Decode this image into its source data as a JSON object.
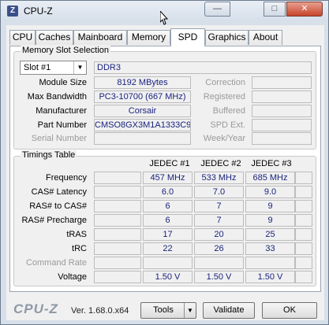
{
  "window": {
    "app_icon": "Z",
    "title": "CPU-Z",
    "minimize": "—",
    "maximize": "□",
    "close": "✕"
  },
  "tabs": [
    "CPU",
    "Caches",
    "Mainboard",
    "Memory",
    "SPD",
    "Graphics",
    "About"
  ],
  "active_tab": "SPD",
  "memory_slot": {
    "group_title": "Memory Slot Selection",
    "slot_value": "Slot #1",
    "type": "DDR3",
    "module_size_label": "Module Size",
    "module_size": "8192 MBytes",
    "max_bandwidth_label": "Max Bandwidth",
    "max_bandwidth": "PC3-10700 (667 MHz)",
    "manufacturer_label": "Manufacturer",
    "manufacturer": "Corsair",
    "part_number_label": "Part Number",
    "part_number": "CMSO8GX3M1A1333C9",
    "serial_number_label": "Serial Number",
    "serial_number": "",
    "correction_label": "Correction",
    "correction": "",
    "registered_label": "Registered",
    "registered": "",
    "buffered_label": "Buffered",
    "buffered": "",
    "spd_ext_label": "SPD Ext.",
    "spd_ext": "",
    "week_year_label": "Week/Year",
    "week_year": ""
  },
  "timings": {
    "group_title": "Timings Table",
    "columns": [
      "JEDEC #1",
      "JEDEC #2",
      "JEDEC #3",
      ""
    ],
    "rows": [
      {
        "label": "Frequency",
        "values": [
          "457 MHz",
          "533 MHz",
          "685 MHz",
          ""
        ]
      },
      {
        "label": "CAS# Latency",
        "values": [
          "6.0",
          "7.0",
          "9.0",
          ""
        ]
      },
      {
        "label": "RAS# to CAS#",
        "values": [
          "6",
          "7",
          "9",
          ""
        ]
      },
      {
        "label": "RAS# Precharge",
        "values": [
          "6",
          "7",
          "9",
          ""
        ]
      },
      {
        "label": "tRAS",
        "values": [
          "17",
          "20",
          "25",
          ""
        ]
      },
      {
        "label": "tRC",
        "values": [
          "22",
          "26",
          "33",
          ""
        ]
      },
      {
        "label": "Command Rate",
        "values": [
          "",
          "",
          "",
          ""
        ]
      },
      {
        "label": "Voltage",
        "values": [
          "1.50 V",
          "1.50 V",
          "1.50 V",
          ""
        ]
      }
    ]
  },
  "footer": {
    "logo": "CPU-Z",
    "version": "Ver. 1.68.0.x64",
    "tools": "Tools",
    "validate": "Validate",
    "ok": "OK"
  }
}
